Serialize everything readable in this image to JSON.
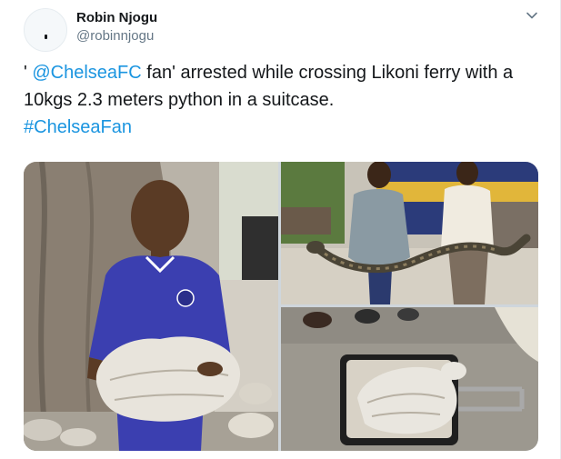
{
  "author": {
    "name": "Robin Njogu",
    "handle": "@robinnjogu"
  },
  "tweet": {
    "prefix": "' ",
    "mention": "@ChelseaFC",
    "text_after_mention": " fan' arrested while crossing Likoni ferry with a 10kgs 2.3 meters python in a suitcase.",
    "hashtag": "#ChelseaFan"
  },
  "icons": {
    "more": "chevron-down-icon",
    "avatar": "avatar-placeholder"
  },
  "colors": {
    "link": "#1b95e0",
    "text": "#14171a",
    "secondary": "#657786",
    "jersey": "#3b3fb0"
  }
}
